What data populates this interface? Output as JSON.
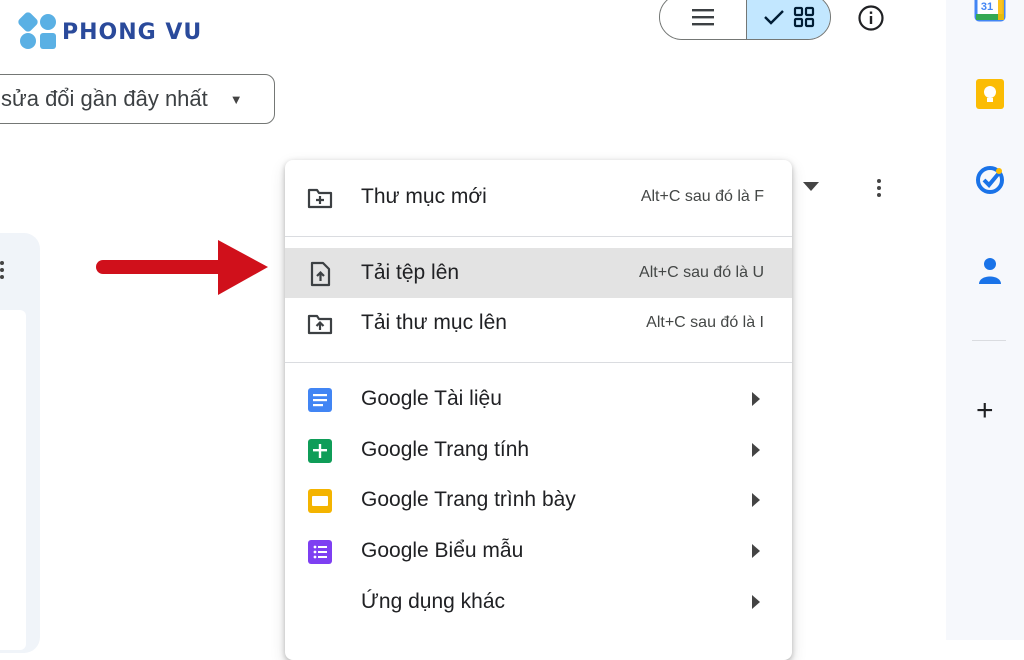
{
  "brand": {
    "logo_text": "PHONG VU"
  },
  "header": {
    "view_toggle": {
      "list_icon": "list-icon",
      "grid_icon": "grid-icon",
      "check_icon": "check-icon"
    },
    "info_icon": "info-icon"
  },
  "toolbar": {
    "sort_label": "sửa đổi gần đây nhất"
  },
  "menu": {
    "items": [
      {
        "label": "Thư mục mới",
        "shortcut": "Alt+C sau đó là F",
        "icon": "new-folder-icon"
      },
      {
        "label": "Tải tệp lên",
        "shortcut": "Alt+C sau đó là U",
        "icon": "file-upload-icon",
        "highlighted": true
      },
      {
        "label": "Tải thư mục lên",
        "shortcut": "Alt+C sau đó là I",
        "icon": "folder-upload-icon"
      },
      {
        "label": "Google Tài liệu",
        "icon": "google-docs-icon",
        "submenu": true
      },
      {
        "label": "Google Trang tính",
        "icon": "google-sheets-icon",
        "submenu": true
      },
      {
        "label": "Google Trang trình bày",
        "icon": "google-slides-icon",
        "submenu": true
      },
      {
        "label": "Google Biểu mẫu",
        "icon": "google-forms-icon",
        "submenu": true
      },
      {
        "label": "Ứng dụng khác",
        "submenu": true
      }
    ]
  },
  "side_panel": {
    "calendar_day": "31",
    "icons": [
      "google-calendar-icon",
      "google-keep-icon",
      "google-tasks-icon",
      "google-contacts-icon",
      "add-icon"
    ]
  },
  "colors": {
    "accent_blue": "#c2e7ff",
    "highlight": "#e3e3e3",
    "arrow_red": "#d0101b",
    "docs_blue": "#4285f4",
    "sheets_green": "#0f9d58",
    "slides_yellow": "#f4b400",
    "forms_purple": "#7e3ff2",
    "logo_blue": "#2a4a9b"
  }
}
